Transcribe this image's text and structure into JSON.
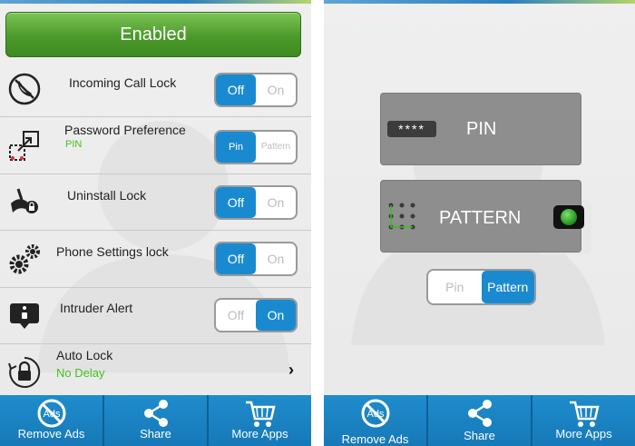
{
  "left": {
    "enabled_label": "Enabled",
    "rows": [
      {
        "title": "Incoming Call Lock",
        "off": "Off",
        "on": "On",
        "state": "off"
      },
      {
        "title": "Password Preference",
        "subtitle": "PIN",
        "pin": "Pin",
        "pattern": "Pattern",
        "state": "pin"
      },
      {
        "title": "Uninstall Lock",
        "off": "Off",
        "on": "On",
        "state": "off"
      },
      {
        "title": "Phone Settings lock",
        "off": "Off",
        "on": "On",
        "state": "off"
      },
      {
        "title": "Intruder Alert",
        "off": "Off",
        "on": "On",
        "state": "on"
      },
      {
        "title": "Auto Lock",
        "subtitle": "No Delay"
      }
    ]
  },
  "right": {
    "pin_badge": "****",
    "pin_label": "PIN",
    "pattern_label": "PATTERN",
    "toggle": {
      "pin": "Pin",
      "pattern": "Pattern",
      "state": "pattern"
    }
  },
  "bottom_bar": {
    "tabs": [
      {
        "label": "Remove Ads",
        "icon": "no-ads-icon",
        "icon_text": "Ads"
      },
      {
        "label": "Share",
        "icon": "share-icon"
      },
      {
        "label": "More Apps",
        "icon": "cart-icon"
      }
    ]
  },
  "colors": {
    "accent_blue": "#1a8ad0",
    "enabled_green": "#4b9a2a",
    "subtitle_green": "#46c11e",
    "bottom_bar": "#1679b8"
  }
}
